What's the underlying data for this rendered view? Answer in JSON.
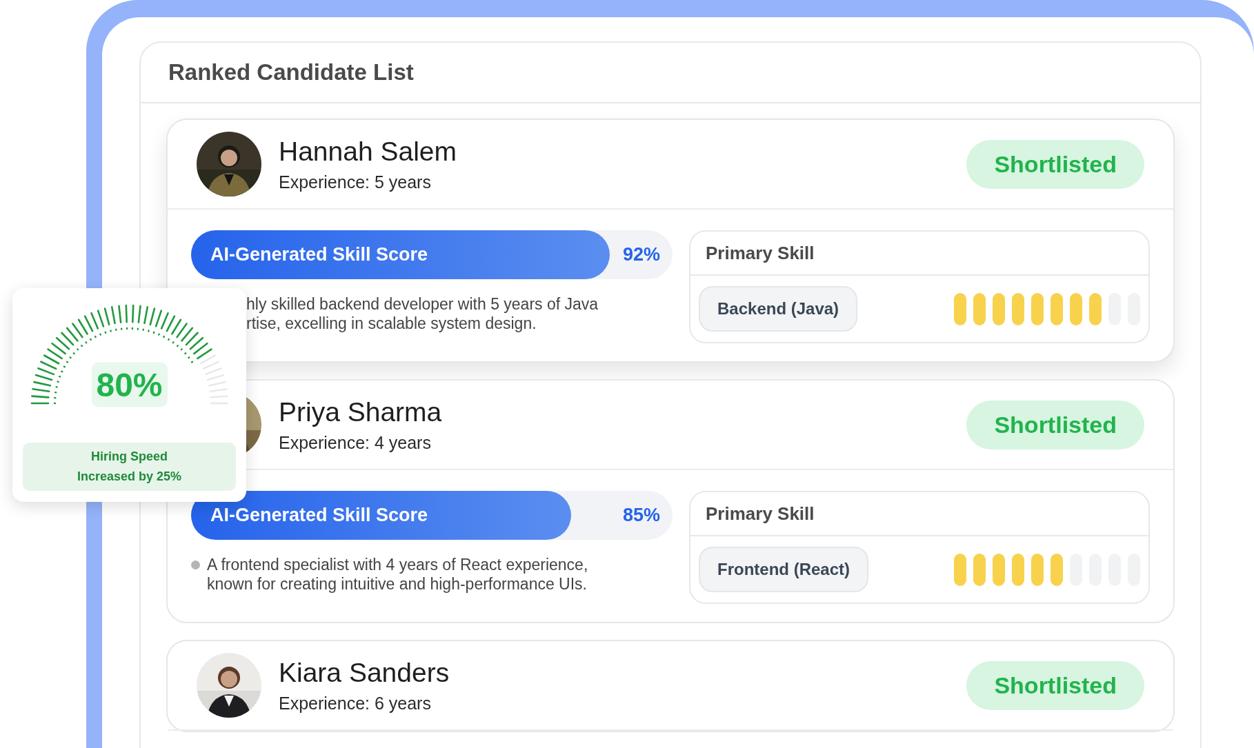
{
  "panel": {
    "title": "Ranked Candidate List"
  },
  "candidates": [
    {
      "name": "Hannah Salem",
      "experience": "Experience: 5 years",
      "status": "Shortlisted",
      "score": {
        "label": "AI-Generated Skill Score",
        "value": "92%",
        "level": 0.87
      },
      "bullet": false,
      "description": [
        "hly skilled backend developer with 5 years of Java",
        "rtise, excelling in scalable system design."
      ],
      "skill": {
        "heading": "Primary Skill",
        "tag": "Backend (Java)",
        "level": 0.8
      }
    },
    {
      "name": "Priya Sharma",
      "experience": "Experience: 4 years",
      "status": "Shortlisted",
      "score": {
        "label": "AI-Generated Skill Score",
        "value": "85%",
        "level": 0.79
      },
      "bullet": true,
      "description": [
        "A frontend specialist with 4 years of React experience,",
        "known for creating intuitive and high-performance UIs."
      ],
      "skill": {
        "heading": "Primary Skill",
        "tag": "Frontend (React)",
        "level": 0.6
      }
    },
    {
      "name": "Kiara Sanders",
      "experience": "Experience: 6 years",
      "status": "Shortlisted"
    }
  ],
  "gauge": {
    "value": "80%",
    "caption": [
      "Hiring Speed",
      "Increased by 25%"
    ]
  }
}
